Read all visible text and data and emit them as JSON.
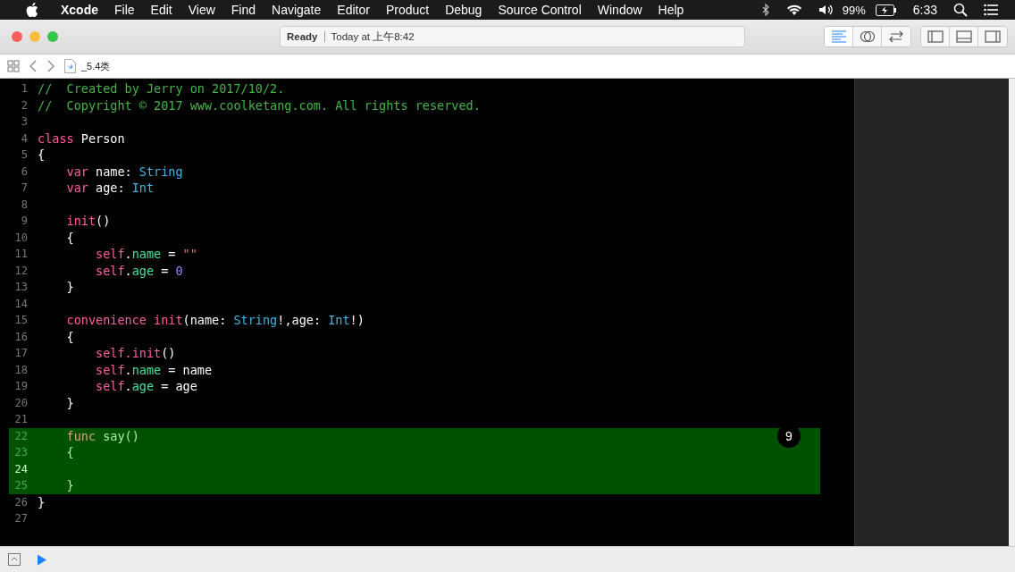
{
  "menu_bar": {
    "app_name": "Xcode",
    "menus": [
      "File",
      "Edit",
      "View",
      "Find",
      "Navigate",
      "Editor",
      "Product",
      "Debug",
      "Source Control",
      "Window",
      "Help"
    ],
    "battery": "99%",
    "time": "6:33"
  },
  "toolbar": {
    "status": "Ready",
    "timestamp": "Today at 上午8:42",
    "editor_modes": [
      {
        "kind": "standard",
        "selected": true
      },
      {
        "kind": "assistant",
        "selected": false
      },
      {
        "kind": "version",
        "selected": false
      }
    ],
    "panels": [
      {
        "kind": "navigator",
        "on": false
      },
      {
        "kind": "debug",
        "on": false
      },
      {
        "kind": "utilities",
        "on": false
      }
    ]
  },
  "jump_bar": {
    "file": "_5.4类"
  },
  "editor": {
    "badge": "9",
    "lines": [
      {
        "number": "1",
        "highlighted": false,
        "current": false,
        "tokens": [
          {
            "kind": "comment",
            "t": "//  Created by Jerry on 2017/10/2."
          }
        ]
      },
      {
        "number": "2",
        "highlighted": false,
        "current": false,
        "tokens": [
          {
            "kind": "comment",
            "t": "//  Copyright © 2017 www.coolketang.com. All rights reserved."
          }
        ]
      },
      {
        "number": "3",
        "highlighted": false,
        "current": false
      },
      {
        "number": "4",
        "highlighted": false,
        "current": false,
        "tokens": [
          {
            "kind": "kw",
            "t": "class"
          },
          {
            "kind": "plain",
            "t": " Person"
          }
        ]
      },
      {
        "number": "5",
        "highlighted": false,
        "current": false,
        "tokens": [
          {
            "kind": "plain",
            "t": "{"
          }
        ]
      },
      {
        "number": "6",
        "highlighted": false,
        "current": false,
        "tokens": [
          {
            "kind": "kw",
            "t": "    var"
          },
          {
            "kind": "plain",
            "t": " name: "
          },
          {
            "kind": "type",
            "t": "String"
          }
        ]
      },
      {
        "number": "7",
        "highlighted": false,
        "current": false,
        "tokens": [
          {
            "kind": "kw",
            "t": "    var"
          },
          {
            "kind": "plain",
            "t": " age: "
          },
          {
            "kind": "type",
            "t": "Int"
          }
        ]
      },
      {
        "number": "8",
        "highlighted": false,
        "current": false
      },
      {
        "number": "9",
        "highlighted": false,
        "current": false,
        "tokens": [
          {
            "kind": "kw",
            "t": "    init"
          },
          {
            "kind": "plain",
            "t": "()"
          }
        ]
      },
      {
        "number": "10",
        "highlighted": false,
        "current": false,
        "tokens": [
          {
            "kind": "plain",
            "t": "    {"
          }
        ]
      },
      {
        "number": "11",
        "highlighted": false,
        "current": false,
        "tokens": [
          {
            "kind": "kw",
            "t": "        self"
          },
          {
            "kind": "plain",
            "t": "."
          },
          {
            "kind": "prop",
            "t": "name"
          },
          {
            "kind": "plain",
            "t": " = "
          },
          {
            "kind": "string",
            "t": "\"\""
          }
        ]
      },
      {
        "number": "12",
        "highlighted": false,
        "current": false,
        "tokens": [
          {
            "kind": "kw",
            "t": "        self"
          },
          {
            "kind": "plain",
            "t": "."
          },
          {
            "kind": "prop",
            "t": "age"
          },
          {
            "kind": "plain",
            "t": " = "
          },
          {
            "kind": "number",
            "t": "0"
          }
        ]
      },
      {
        "number": "13",
        "highlighted": false,
        "current": false,
        "tokens": [
          {
            "kind": "plain",
            "t": "    }"
          }
        ]
      },
      {
        "number": "14",
        "highlighted": false,
        "current": false
      },
      {
        "number": "15",
        "highlighted": false,
        "current": false,
        "tokens": [
          {
            "kind": "kw",
            "t": "    convenience init"
          },
          {
            "kind": "plain",
            "t": "(name: "
          },
          {
            "kind": "type",
            "t": "String"
          },
          {
            "kind": "plain",
            "t": "!,age: "
          },
          {
            "kind": "type",
            "t": "Int"
          },
          {
            "kind": "plain",
            "t": "!)"
          }
        ]
      },
      {
        "number": "16",
        "highlighted": false,
        "current": false,
        "tokens": [
          {
            "kind": "plain",
            "t": "    {"
          }
        ]
      },
      {
        "number": "17",
        "highlighted": false,
        "current": false,
        "tokens": [
          {
            "kind": "kw",
            "t": "        self.init"
          },
          {
            "kind": "plain",
            "t": "()"
          }
        ]
      },
      {
        "number": "18",
        "highlighted": false,
        "current": false,
        "tokens": [
          {
            "kind": "kw",
            "t": "        self"
          },
          {
            "kind": "plain",
            "t": "."
          },
          {
            "kind": "prop",
            "t": "name"
          },
          {
            "kind": "plain",
            "t": " = name"
          }
        ]
      },
      {
        "number": "19",
        "highlighted": false,
        "current": false,
        "tokens": [
          {
            "kind": "kw",
            "t": "        self"
          },
          {
            "kind": "plain",
            "t": "."
          },
          {
            "kind": "prop",
            "t": "age"
          },
          {
            "kind": "plain",
            "t": " = age"
          }
        ]
      },
      {
        "number": "20",
        "highlighted": false,
        "current": false,
        "tokens": [
          {
            "kind": "plain",
            "t": "    }"
          }
        ]
      },
      {
        "number": "21",
        "highlighted": false,
        "current": false
      },
      {
        "number": "22",
        "highlighted": true,
        "current": false,
        "tokens": [
          {
            "kind": "kw",
            "t": "    func"
          },
          {
            "kind": "plain",
            "t": " say()"
          }
        ]
      },
      {
        "number": "23",
        "highlighted": true,
        "current": false,
        "tokens": [
          {
            "kind": "plain",
            "t": "    {"
          }
        ]
      },
      {
        "number": "24",
        "highlighted": true,
        "current": true
      },
      {
        "number": "25",
        "highlighted": true,
        "current": false,
        "tokens": [
          {
            "kind": "plain",
            "t": "    }"
          }
        ]
      },
      {
        "number": "26",
        "highlighted": false,
        "current": false,
        "tokens": [
          {
            "kind": "plain",
            "t": "}"
          }
        ]
      },
      {
        "number": "27",
        "highlighted": false,
        "current": false
      }
    ]
  }
}
